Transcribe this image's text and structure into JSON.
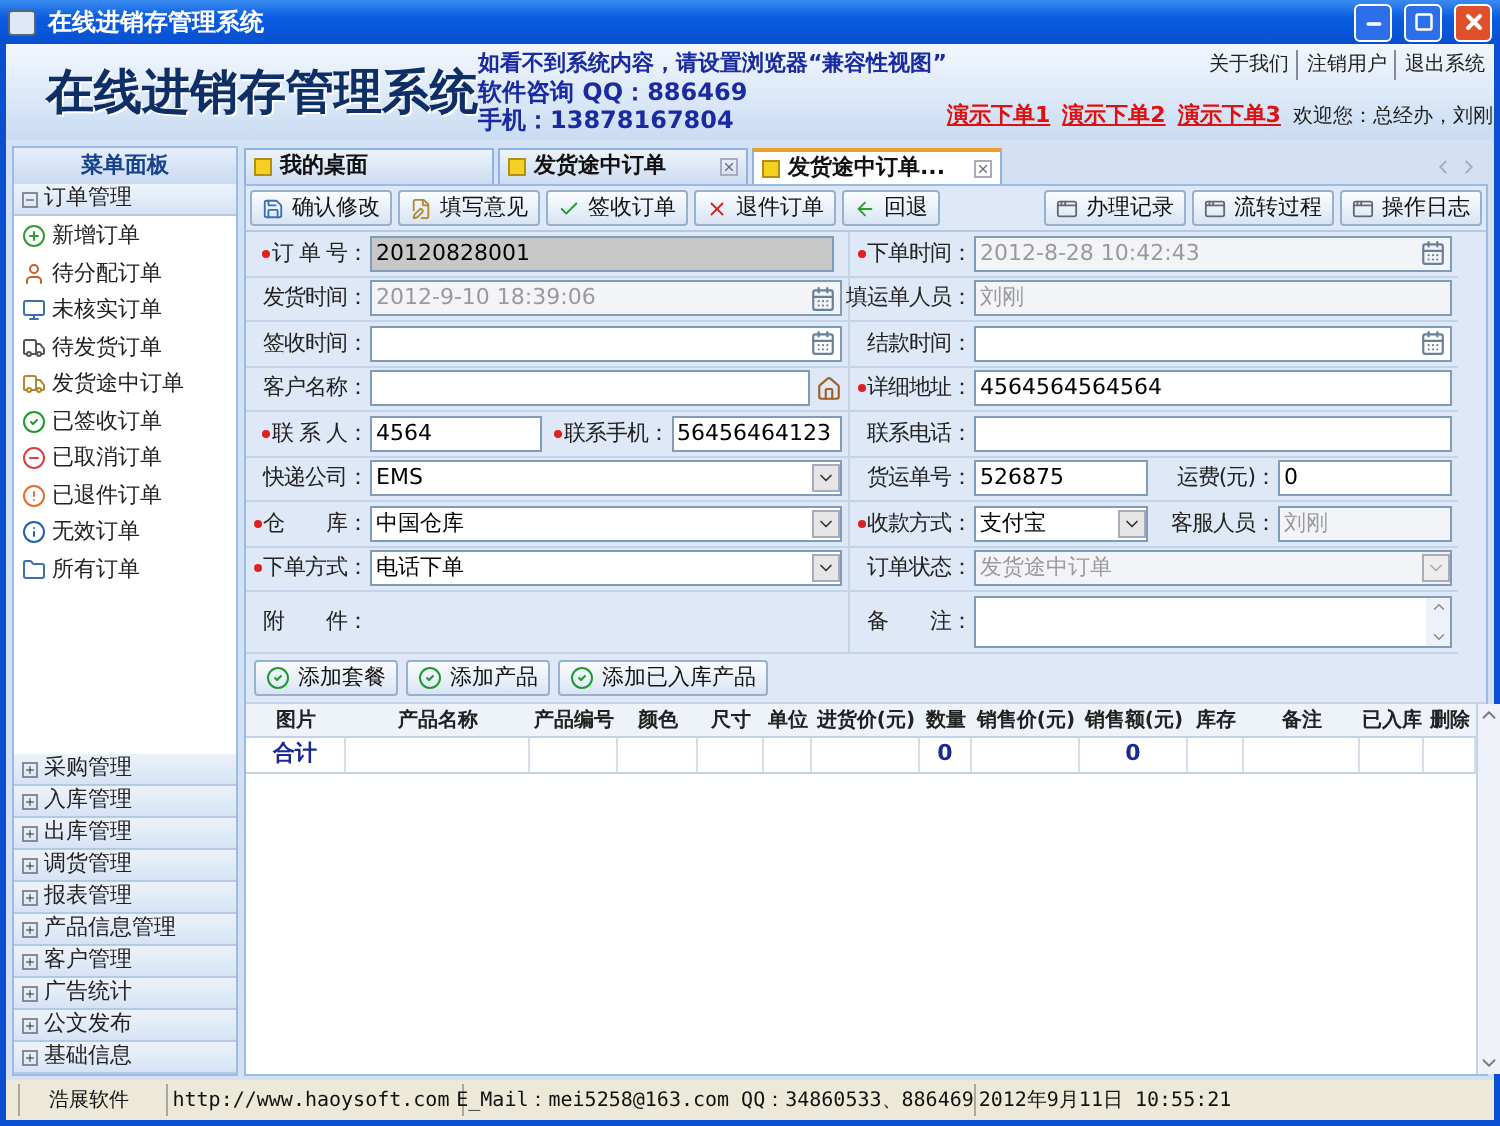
{
  "window": {
    "title": "在线进销存管理系统"
  },
  "header": {
    "title": "在线进销存管理系统",
    "notice": "如看不到系统内容，请设置浏览器“兼容性视图”",
    "consult": "软件咨询 QQ：886469",
    "phone": "手机：13878167804",
    "top_links": [
      "关于我们",
      "注销用户",
      "退出系统"
    ],
    "demo_links": [
      "演示下单1",
      "演示下单2",
      "演示下单3"
    ],
    "welcome": "欢迎您：总经办，刘刚"
  },
  "sidebar": {
    "title": "菜单面板",
    "groups": [
      {
        "label": "订单管理",
        "expanded": true,
        "children": [
          {
            "label": "新增订单"
          },
          {
            "label": "待分配订单"
          },
          {
            "label": "未核实订单"
          },
          {
            "label": "待发货订单"
          },
          {
            "label": "发货途中订单"
          },
          {
            "label": "已签收订单"
          },
          {
            "label": "已取消订单"
          },
          {
            "label": "已退件订单"
          },
          {
            "label": "无效订单"
          },
          {
            "label": "所有订单"
          }
        ]
      },
      {
        "label": "采购管理",
        "expanded": false
      },
      {
        "label": "入库管理",
        "expanded": false
      },
      {
        "label": "出库管理",
        "expanded": false
      },
      {
        "label": "调货管理",
        "expanded": false
      },
      {
        "label": "报表管理",
        "expanded": false
      },
      {
        "label": "产品信息管理",
        "expanded": false
      },
      {
        "label": "客户管理",
        "expanded": false
      },
      {
        "label": "广告统计",
        "expanded": false
      },
      {
        "label": "公文发布",
        "expanded": false
      },
      {
        "label": "基础信息",
        "expanded": false
      }
    ]
  },
  "tabs": [
    {
      "label": "我的桌面",
      "selected": false,
      "closable": false
    },
    {
      "label": "发货途中订单",
      "selected": false,
      "closable": true
    },
    {
      "label": "发货途中订单...",
      "selected": true,
      "closable": true
    }
  ],
  "toolbar": {
    "left_buttons": [
      "确认修改",
      "填写意见",
      "签收订单",
      "退件订单",
      "回退"
    ],
    "right_buttons": [
      "办理记录",
      "流转过程",
      "操作日志"
    ]
  },
  "form": {
    "rows": [
      {
        "left": [
          {
            "label": "订 单 号：",
            "required": true,
            "kind": "locked",
            "value": "20120828001"
          }
        ],
        "right": [
          {
            "label": "下单时间：",
            "required": true,
            "kind": "date",
            "value": "2012-8-28 10:42:43",
            "disabled": true
          }
        ]
      },
      {
        "left": [
          {
            "label": "发货时间：",
            "required": false,
            "kind": "date",
            "value": "2012-9-10 18:39:06",
            "disabled": true
          }
        ],
        "right": [
          {
            "label": "填运单人员：",
            "required": false,
            "kind": "text",
            "value": "刘刚",
            "disabled": true
          }
        ]
      },
      {
        "left": [
          {
            "label": "签收时间：",
            "required": false,
            "kind": "date",
            "disabled": false
          }
        ],
        "right": [
          {
            "label": "结款时间：",
            "required": false,
            "kind": "date",
            "disabled": false
          }
        ]
      },
      {
        "left": [
          {
            "label": "客户名称：",
            "required": false,
            "kind": "lookup",
            "disabled": false
          }
        ],
        "right": [
          {
            "label": "详细地址：",
            "required": true,
            "kind": "text",
            "value": "4564564564564",
            "disabled": false
          }
        ]
      },
      {
        "left": [
          {
            "label": "联 系 人：",
            "required": true,
            "kind": "text",
            "value": "4564",
            "disabled": false
          },
          {
            "label": "联系手机：",
            "required": true,
            "kind": "text",
            "value": "56456464123",
            "disabled": false
          }
        ],
        "right": [
          {
            "label": "联系电话：",
            "required": false,
            "kind": "text",
            "disabled": false
          }
        ]
      },
      {
        "left": [
          {
            "label": "快递公司：",
            "required": false,
            "kind": "select",
            "value": "EMS",
            "disabled": false
          }
        ],
        "right": [
          {
            "label": "货运单号：",
            "required": false,
            "kind": "text",
            "value": "526875",
            "disabled": false
          },
          {
            "label": "运费(元)：",
            "required": false,
            "kind": "text",
            "value": "0",
            "disabled": false
          }
        ]
      },
      {
        "left": [
          {
            "label": "仓　　库：",
            "required": true,
            "kind": "select",
            "value": "中国仓库",
            "disabled": false
          }
        ],
        "right": [
          {
            "label": "收款方式：",
            "required": true,
            "kind": "select",
            "value": "支付宝",
            "disabled": false
          },
          {
            "label": "客服人员：",
            "required": false,
            "kind": "text",
            "value": "刘刚",
            "disabled": true
          }
        ]
      },
      {
        "left": [
          {
            "label": "下单方式：",
            "required": true,
            "kind": "select",
            "value": "电话下单",
            "disabled": false
          }
        ],
        "right": [
          {
            "label": "订单状态：",
            "required": false,
            "kind": "select",
            "value": "发货途中订单",
            "disabled": true
          }
        ]
      },
      {
        "left": [
          {
            "label": "附　　件：",
            "required": false,
            "kind": "static"
          }
        ],
        "right": [
          {
            "label": "备　　注：",
            "required": false,
            "kind": "textarea",
            "disabled": false
          }
        ]
      }
    ]
  },
  "actions": [
    "添加套餐",
    "添加产品",
    "添加已入库产品"
  ],
  "table": {
    "columns": [
      "图片",
      "产品名称",
      "产品编号",
      "颜色",
      "尺寸",
      "单位",
      "进货价(元)",
      "数量",
      "销售价(元)",
      "销售额(元)",
      "库存",
      "备注",
      "已入库",
      "删除"
    ],
    "total": {
      "label": "合计",
      "quantity": "0",
      "sales_amount": "0"
    }
  },
  "status_bar": [
    "浩展软件",
    "http://www.haoysoft.com",
    "E_Mail：mei5258@163.com  QQ：34860533、886469",
    "2012年9月11日  10:55:21"
  ]
}
